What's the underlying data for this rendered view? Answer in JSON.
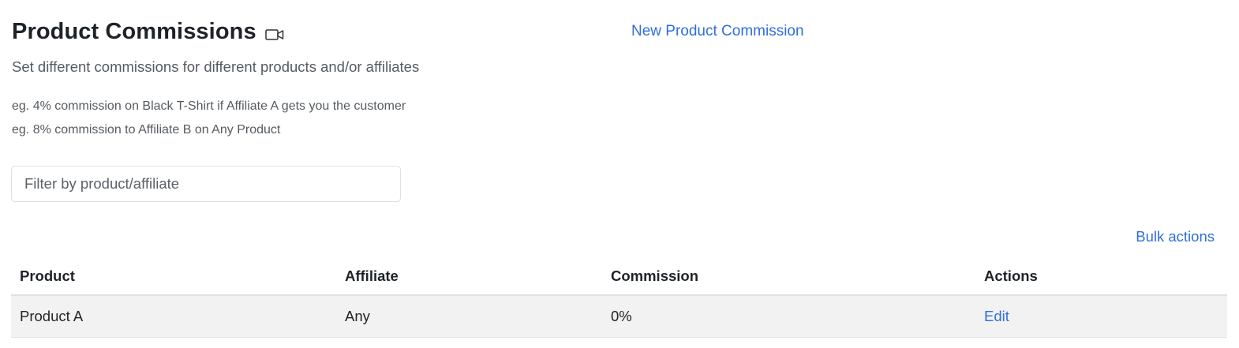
{
  "header": {
    "title": "Product Commissions",
    "video_icon": "video-camera-icon",
    "new_link": "New Product Commission",
    "subtitle": "Set different commissions for different products and/or affiliates",
    "examples": [
      "eg. 4% commission on Black T-Shirt if Affiliate A gets you the customer",
      "eg. 8% commission to Affiliate B on Any Product"
    ]
  },
  "filter": {
    "placeholder": "Filter by product/affiliate",
    "value": ""
  },
  "bulk_actions_label": "Bulk actions",
  "table": {
    "columns": [
      "Product",
      "Affiliate",
      "Commission",
      "Actions"
    ],
    "rows": [
      {
        "product": "Product A",
        "affiliate": "Any",
        "commission": "0%",
        "action": "Edit"
      }
    ]
  },
  "colors": {
    "link": "#2f6fdb",
    "row_bg": "#f2f2f2",
    "text": "#212529",
    "muted": "#555b61"
  }
}
